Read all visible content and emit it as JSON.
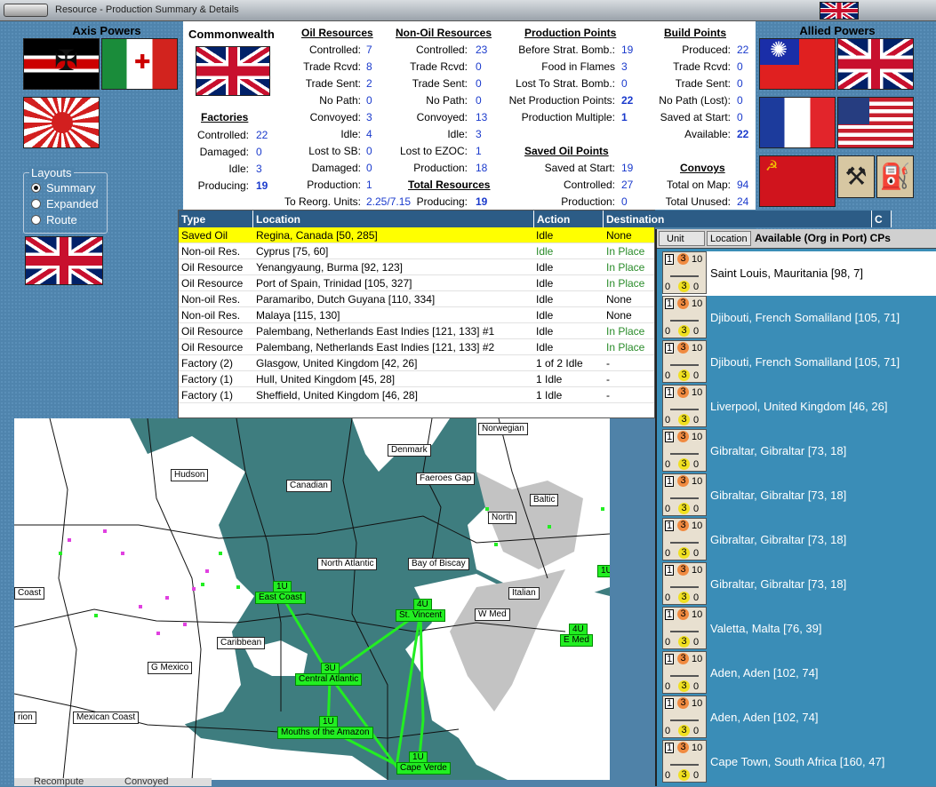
{
  "window": {
    "title": "Resource - Production Summary & Details"
  },
  "axis": {
    "header": "Axis Powers"
  },
  "allied": {
    "header": "Allied Powers"
  },
  "layouts": {
    "legend": "Layouts",
    "options": [
      "Summary",
      "Expanded",
      "Route"
    ],
    "selected": "Summary"
  },
  "summary": {
    "nation": "Commonwealth",
    "oil": {
      "title": "Oil Resources",
      "rows": [
        [
          "Controlled:",
          "7"
        ],
        [
          "Trade Rcvd:",
          "8"
        ],
        [
          "Trade Sent:",
          "2"
        ],
        [
          "No Path:",
          "0"
        ],
        [
          "Convoyed:",
          "3"
        ],
        [
          "Idle:",
          "4"
        ],
        [
          "Lost to SB:",
          "0"
        ],
        [
          "Damaged:",
          "0"
        ],
        [
          "Production:",
          "1"
        ],
        [
          "To Reorg. Units:",
          "2.25/7.15"
        ]
      ]
    },
    "nonoil": {
      "title": "Non-Oil Resources",
      "rows": [
        [
          "Controlled:",
          "23"
        ],
        [
          "Trade Rcvd:",
          "0"
        ],
        [
          "Trade Sent:",
          "0"
        ],
        [
          "No Path:",
          "0"
        ],
        [
          "Convoyed:",
          "13"
        ],
        [
          "Idle:",
          "3"
        ],
        [
          "Lost to EZOC:",
          "1"
        ],
        [
          "Production:",
          "18"
        ]
      ]
    },
    "total": {
      "title": "Total Resources",
      "label": "Producing:",
      "value": "19"
    },
    "factories": {
      "title": "Factories",
      "rows": [
        [
          "Controlled:",
          "22"
        ],
        [
          "Damaged:",
          "0"
        ],
        [
          "Idle:",
          "3"
        ],
        [
          "Producing:",
          "19"
        ]
      ]
    },
    "pp": {
      "title": "Production Points",
      "rows": [
        [
          "Before Strat. Bomb.:",
          "19"
        ],
        [
          "Food in Flames",
          "3"
        ],
        [
          "Lost To Strat. Bomb.:",
          "0"
        ],
        [
          "Net Production Points:",
          "22"
        ],
        [
          "Production Multiple:",
          "1"
        ]
      ]
    },
    "savedoil": {
      "title": "Saved Oil Points",
      "rows": [
        [
          "Saved at Start:",
          "19"
        ],
        [
          "Controlled:",
          "27"
        ],
        [
          "Production:",
          "0"
        ]
      ]
    },
    "bp": {
      "title": "Build Points",
      "rows": [
        [
          "Produced:",
          "22"
        ],
        [
          "Trade Rcvd:",
          "0"
        ],
        [
          "Trade Sent:",
          "0"
        ],
        [
          "No Path (Lost):",
          "0"
        ],
        [
          "Saved at Start:",
          "0"
        ],
        [
          "Available:",
          "22"
        ]
      ]
    },
    "convoys": {
      "title": "Convoys",
      "rows": [
        [
          "Total on Map:",
          "94"
        ],
        [
          "Total Unused:",
          "24"
        ]
      ]
    }
  },
  "table": {
    "headers": [
      "Type",
      "Location",
      "Action",
      "Destination",
      "C"
    ],
    "rows": [
      [
        "Saved Oil",
        "Regina, Canada [50, 285]",
        "Idle",
        "None"
      ],
      [
        "Non-oil Res.",
        "Cyprus [75, 60]",
        "Idle",
        "In Place"
      ],
      [
        "Oil Resource",
        "Yenangyaung, Burma [92, 123]",
        "Idle",
        "In Place"
      ],
      [
        "Oil Resource",
        "Port of Spain, Trinidad [105, 327]",
        "Idle",
        "In Place"
      ],
      [
        "Non-oil Res.",
        "Paramaribo, Dutch Guyana [110, 334]",
        "Idle",
        "None"
      ],
      [
        "Non-oil Res.",
        "Malaya [115, 130]",
        "Idle",
        "None"
      ],
      [
        "Oil Resource",
        "Palembang, Netherlands East Indies [121, 133] #1",
        "Idle",
        "In Place"
      ],
      [
        "Oil Resource",
        "Palembang, Netherlands East Indies [121, 133] #2",
        "Idle",
        "In Place"
      ],
      [
        "Factory (2)",
        "Glasgow, United Kingdom [42, 26]",
        "1 of 2 Idle",
        "-"
      ],
      [
        "Factory (1)",
        "Hull, United Kingdom [45, 28]",
        "1 Idle",
        "-"
      ],
      [
        "Factory (1)",
        "Sheffield, United Kingdom [46, 28]",
        "1 Idle",
        "-"
      ]
    ]
  },
  "cp_panel": {
    "col_unit": "Unit",
    "col_location": "Location",
    "title": "Available (Org in Port) CPs",
    "unit": {
      "a": "1",
      "o": "3",
      "t": "10",
      "bl": "0",
      "by": "3",
      "br": "0"
    },
    "items": [
      "Saint Louis, Mauritania [98, 7]",
      "Djibouti, French Somaliland [105, 71]",
      "Djibouti, French Somaliland [105, 71]",
      "Liverpool, United Kingdom [46, 26]",
      "Gibraltar, Gibraltar [73, 18]",
      "Gibraltar, Gibraltar [73, 18]",
      "Gibraltar, Gibraltar [73, 18]",
      "Gibraltar, Gibraltar [73, 18]",
      "Valetta, Malta [76, 39]",
      "Aden, Aden [102, 74]",
      "Aden, Aden [102, 74]",
      "Cape Town, South Africa [160, 47]"
    ]
  },
  "map": {
    "sea_labels": [
      "Norwegian",
      "Denmark",
      "Hudson",
      "Canadian",
      "Faeroes Gap",
      "Baltic",
      "North",
      "North Atlantic",
      "Bay of Biscay",
      "Coast",
      "Italian",
      "W Med",
      "Caribbean",
      "G Mexico",
      "Mexican Coast",
      "rion"
    ],
    "route_labels": [
      "East Coast",
      "St. Vincent",
      "E Med",
      "Central Atlantic",
      "Mouths of the Amazon",
      "Cape Verde"
    ],
    "route_counts": [
      "1U",
      "4U",
      "4U",
      "3U",
      "1U",
      "1U",
      "1U"
    ]
  },
  "bottom": {
    "recompute": "Recompute",
    "convoyed": "Convoyed"
  }
}
